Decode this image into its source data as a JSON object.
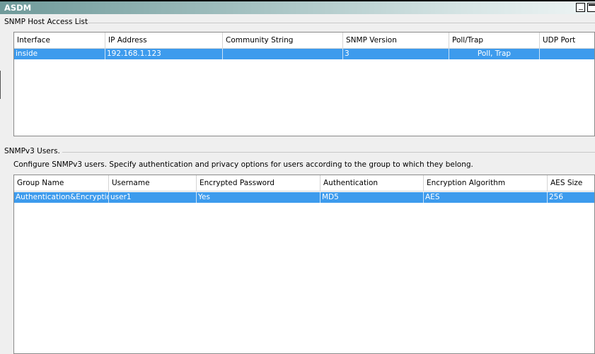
{
  "window": {
    "title": "ASDM",
    "minimize_icon": "minimize-icon",
    "maximize_icon": "maximize-icon"
  },
  "host_access": {
    "group_label": "SNMP Host Access List",
    "columns": [
      "Interface",
      "IP Address",
      "Community String",
      "SNMP Version",
      "Poll/Trap",
      "UDP Port"
    ],
    "rows": [
      {
        "interface": "inside",
        "ip_address": "192.168.1.123",
        "community_string": "",
        "snmp_version": "3",
        "poll_trap": "Poll, Trap",
        "udp_port": "",
        "selected": true
      }
    ]
  },
  "snmpv3_users": {
    "group_label": "SNMPv3 Users.",
    "description": "Configure SNMPv3 users. Specify authentication and privacy options for users according to the group to which they belong.",
    "columns": [
      "Group Name",
      "Username",
      "Encrypted Password",
      "Authentication",
      "Encryption Algorithm",
      "AES Size"
    ],
    "rows": [
      {
        "group_name": "Authentication&Encryption",
        "username": "user1",
        "encrypted_password": "Yes",
        "authentication": "MD5",
        "encryption_algorithm": "AES",
        "aes_size": "256",
        "selected": true
      }
    ]
  },
  "colors": {
    "selection": "#3d9bed",
    "panel_bg": "#efefef",
    "title_start": "#6f9a9a"
  }
}
